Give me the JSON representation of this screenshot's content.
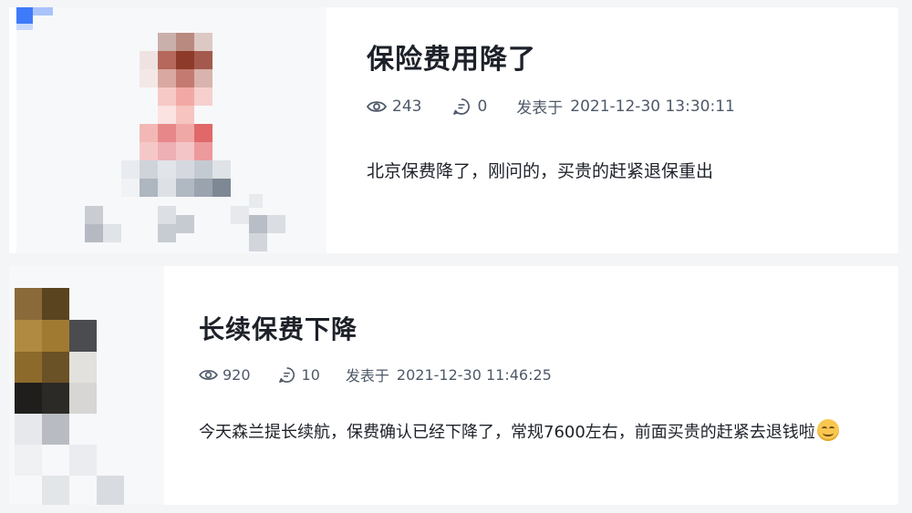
{
  "posts": [
    {
      "title": "保险费用降了",
      "views": "243",
      "comments": "0",
      "posted_label": "发表于",
      "posted_time": "2021-12-30 13:30:11",
      "excerpt": "北京保费降了，刚问的，买贵的赶紧退保重出"
    },
    {
      "title": "长续保费下降",
      "views": "920",
      "comments": "10",
      "posted_label": "发表于",
      "posted_time": "2021-12-30 11:46:25",
      "excerpt": "今天森兰提长续航，保费确认已经下降了，常规7600左右，前面买贵的赶紧去退钱啦"
    }
  ],
  "colors": {
    "background": "#f4f5f7",
    "card": "#ffffff",
    "title": "#1d2129",
    "meta": "#4e5969",
    "corner_accent": "#3e7bfa"
  },
  "icons": [
    "eye-icon",
    "comment-icon",
    "smile-emoji-icon"
  ]
}
